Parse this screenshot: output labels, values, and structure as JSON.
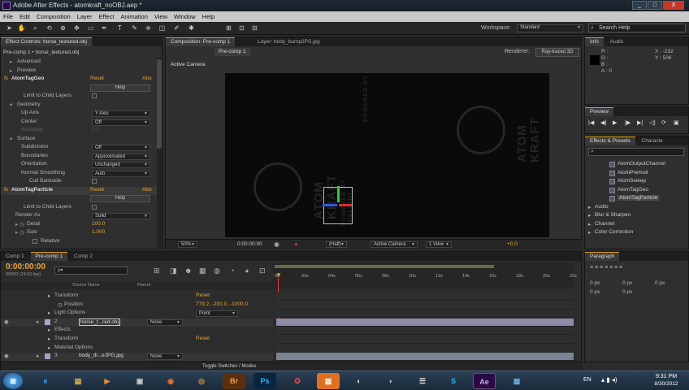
{
  "window": {
    "title": "Adobe After Effects - atomkraft_noOBJ.aep *",
    "min": "_",
    "max": "□",
    "close": "X"
  },
  "menu": [
    "File",
    "Edit",
    "Composition",
    "Layer",
    "Effect",
    "Animation",
    "View",
    "Window",
    "Help"
  ],
  "toolbar": {
    "workspace_label": "Workspace:",
    "workspace_value": "Standard",
    "search_placeholder": "Search Help"
  },
  "effect_controls": {
    "tab": "Effect Controls: horse_textured.obj",
    "breadcrumb": "Pre-comp 1 • horse_textured.obj",
    "rows": [
      {
        "label": "Advanced",
        "indent": 1,
        "tw": "▸"
      },
      {
        "label": "Preview",
        "indent": 1,
        "tw": "▸"
      },
      {
        "label": "AtomTagGeo",
        "indent": 0,
        "tw": "fx",
        "reset": "Reset",
        "about": "Abo",
        "bold": true
      },
      {
        "label": "",
        "help": "Help"
      },
      {
        "label": "Limit to Child Layers",
        "indent": 2,
        "check": true
      },
      {
        "label": "Geometry",
        "indent": 1,
        "tw": "▾"
      },
      {
        "label": "Up Axis",
        "indent": 3,
        "dd": "Y Axis"
      },
      {
        "label": "Center",
        "indent": 3,
        "dd": "Off"
      },
      {
        "label": "Accuracy",
        "indent": 3,
        "dim": true,
        "val": "0.0"
      },
      {
        "label": "Surface",
        "indent": 1,
        "tw": "▾"
      },
      {
        "label": "Subdivision",
        "indent": 3,
        "dd": "Off"
      },
      {
        "label": "Boundaries",
        "indent": 3,
        "dd": "Approximated"
      },
      {
        "label": "Orientation",
        "indent": 3,
        "dd": "Unchanged"
      },
      {
        "label": "Normal Smoothing",
        "indent": 3,
        "dd": "Auto"
      },
      {
        "label": "Cull Backside",
        "indent": 3,
        "check": true
      },
      {
        "label": "AtomTagParticle",
        "indent": 0,
        "tw": "fx",
        "reset": "Reset",
        "about": "Abo",
        "bold": true,
        "hl": true
      },
      {
        "label": "",
        "help": "Help"
      },
      {
        "label": "Limit to Child Layers",
        "indent": 2,
        "check": true
      },
      {
        "label": "Render As",
        "indent": 2,
        "dd": "Solid"
      },
      {
        "label": "Detail",
        "indent": 2,
        "tw": "▸ ◷",
        "val": "100.0"
      },
      {
        "label": "Size",
        "indent": 2,
        "tw": "▸ ◷",
        "val": "1.000"
      },
      {
        "label": "Relative",
        "indent": 5,
        "check": true
      }
    ]
  },
  "composition": {
    "tab": "Composition: Pre-comp 1",
    "layer_tab": "Layer: body_bump2PS.jpg",
    "subtab": "Pre-comp 1",
    "renderer_label": "Renderer:",
    "renderer_value": "Ray-traced 3D",
    "view_label": "Active Camera",
    "bottom": {
      "zoom": "50%",
      "time": "0:00:00:00",
      "res": "(Half)",
      "camera": "Active Camera",
      "views": "1 View",
      "exposure": "+0.0"
    },
    "logo_text": [
      "ATOM",
      "KRAFT",
      "POWERED BY",
      "3DELIGHT"
    ]
  },
  "info": {
    "tabs": [
      "Info",
      "Audio"
    ],
    "r": "R :",
    "g": "G :",
    "b": "B :",
    "a": "A : 0",
    "x": "X : -232",
    "y": "Y : 506"
  },
  "preview": {
    "tab": "Preview",
    "buttons": [
      "|◀",
      "◀|",
      "▶",
      "|▶",
      "▶|",
      "◁)",
      "⟳",
      "▣"
    ]
  },
  "effects_presets": {
    "tabs": [
      "Effects & Presets",
      "Characte"
    ],
    "search": "",
    "items": [
      {
        "label": "AtomOutputChannel",
        "indent": 2
      },
      {
        "label": "AtomPremult",
        "indent": 2
      },
      {
        "label": "AtomSweep",
        "indent": 2
      },
      {
        "label": "AtomTagGeo",
        "indent": 2
      },
      {
        "label": "AtomTagParticle",
        "indent": 2,
        "selected": true
      },
      {
        "label": "Audio",
        "indent": 0
      },
      {
        "label": "Blur & Sharpen",
        "indent": 0
      },
      {
        "label": "Channel",
        "indent": 0
      },
      {
        "label": "Color Correction",
        "indent": 0
      }
    ]
  },
  "paragraph": {
    "tab": "Paragraph",
    "fields": [
      "0 px",
      "0 px",
      "0 px",
      "0 px",
      "0 px"
    ]
  },
  "timeline": {
    "tabs": [
      "Comp 1",
      "Pre-comp 1",
      "Comp 2"
    ],
    "timecode": "0:00:00:00",
    "fps": "00000 (24.00 fps)",
    "search_placeholder": "ρ▾",
    "headers": {
      "source": "Source Name",
      "parent": "Parent"
    },
    "ruler": [
      "0s",
      "02s",
      "04s",
      "06s",
      "08s",
      "10s",
      "12s",
      "14s",
      "16s",
      "18s",
      "20s",
      "22s"
    ],
    "rows": [
      {
        "label": "Transform",
        "indent": 1,
        "reset": "Reset"
      },
      {
        "label": "Position",
        "indent": 3,
        "val": "779.2, -200.0, -1000.0"
      },
      {
        "label": "Light Options",
        "indent": 1,
        "dd": "Point"
      },
      {
        "label": "horse_t...red.obj",
        "num": "2",
        "layer": true,
        "parent": "None",
        "selected": true
      },
      {
        "label": "Effects",
        "indent": 1
      },
      {
        "label": "Transform",
        "indent": 1,
        "reset": "Reset"
      },
      {
        "label": "Material Options",
        "indent": 1
      },
      {
        "label": "body_di...eJPG.jpg",
        "num": "3",
        "layer": true,
        "parent": "None"
      }
    ],
    "footer": "Toggle Switches / Modes"
  },
  "taskbar": {
    "lang": "EN",
    "time": "9:31 PM",
    "date": "8/30/2012"
  }
}
